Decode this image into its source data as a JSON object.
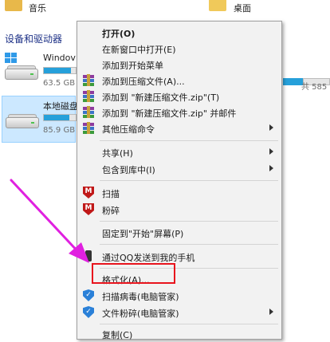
{
  "explorer": {
    "folders": [
      {
        "label": "音乐"
      },
      {
        "label": "桌面"
      }
    ],
    "section_header": "设备和驱动器",
    "drives": [
      {
        "name": "Windov",
        "size": "63.5 GB",
        "usage": 0.85
      },
      {
        "name": "本地磁盘",
        "size": "85.9 GB",
        "usage": 0.8
      }
    ],
    "right_free_text": "共 585"
  },
  "menu": {
    "items": [
      {
        "label": "打开(O)",
        "bold": true
      },
      {
        "label": "在新窗口中打开(E)"
      },
      {
        "label": "添加到开始菜单"
      },
      {
        "label": "添加到压缩文件(A)...",
        "icon": "winrar-icon"
      },
      {
        "label": "添加到 \"新建压缩文件.zip\"(T)",
        "icon": "winrar-icon"
      },
      {
        "label": "添加到 \"新建压缩文件.zip\" 并邮件",
        "icon": "winrar-icon"
      },
      {
        "label": "其他压缩命令",
        "icon": "winrar-icon",
        "submenu": true
      },
      {
        "label": "共享(H)",
        "submenu": true
      },
      {
        "label": "包含到库中(I)",
        "submenu": true
      },
      {
        "label": "扫描",
        "icon": "mcafee-icon"
      },
      {
        "label": "粉碎",
        "icon": "mcafee-icon"
      },
      {
        "label": "固定到\"开始\"屏幕(P)"
      },
      {
        "label": "通过QQ发送到我的手机",
        "icon": "phone-icon"
      },
      {
        "label": "格式化(A)..."
      },
      {
        "label": "扫描病毒(电脑管家)",
        "icon": "guard-shield-icon"
      },
      {
        "label": "文件粉碎(电脑管家)",
        "icon": "guard-shield-icon",
        "submenu": true
      },
      {
        "label": "复制(C)"
      }
    ]
  },
  "colors": {
    "highlight_border": "#e8141d",
    "arrow": "#e020e0",
    "accent_bar": "#26a0da"
  }
}
